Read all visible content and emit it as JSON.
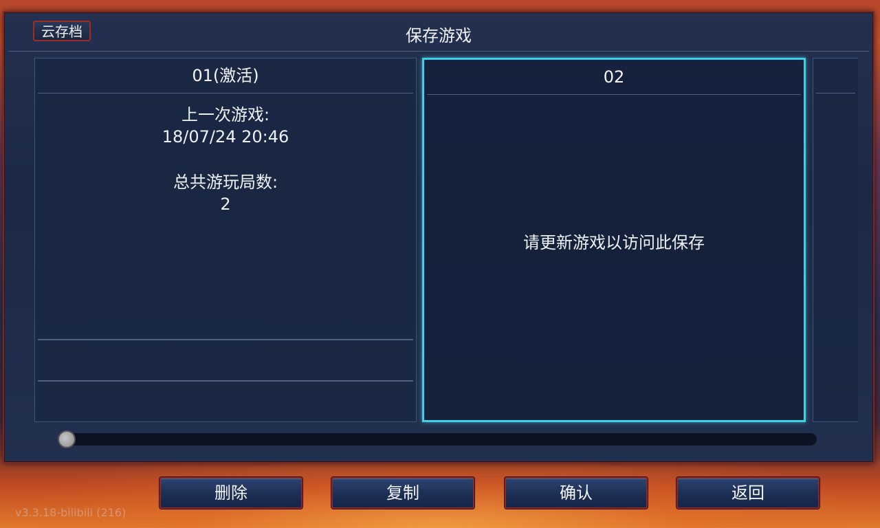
{
  "header": {
    "cloud_button_label": "云存档",
    "title": "保存游戏"
  },
  "slots": [
    {
      "title": "01(激活)",
      "last_played_label": "上一次游戏:",
      "last_played_value": "18/07/24 20:46",
      "total_runs_label": "总共游玩局数:",
      "total_runs_value": "2"
    },
    {
      "title": "02",
      "message": "请更新游戏以访问此保存"
    }
  ],
  "scrollbar": {
    "position": 0
  },
  "buttons": {
    "delete": "删除",
    "copy": "复制",
    "confirm": "确认",
    "back": "返回"
  },
  "version": "v3.3.18-bilibili (216)",
  "colors": {
    "selected_border": "#3fd0e8",
    "button_border": "#8a2a22",
    "panel_bg": "#1c2946"
  }
}
